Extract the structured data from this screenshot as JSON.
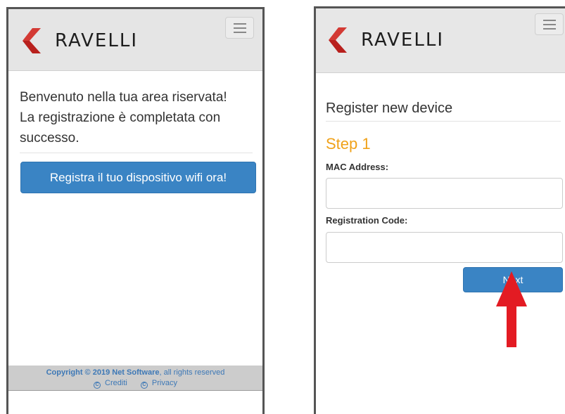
{
  "left_screen": {
    "brand": "RAVELLI",
    "welcome_line_1": "Benvenuto nella tua area riservata!",
    "welcome_line_2": "La registrazione è completata con successo.",
    "register_button": "Registra il tuo dispositivo wifi ora!",
    "footer": {
      "copyright_prefix": "Copyright © 2019 Net Software",
      "copyright_suffix": ", all rights reserved",
      "credits": "Crediti",
      "privacy": "Privacy"
    }
  },
  "right_screen": {
    "brand": "RAVELLI",
    "page_title": "Register new device",
    "step_title": "Step 1",
    "mac_label": "MAC Address:",
    "mac_value": "",
    "code_label": "Registration Code:",
    "code_value": "",
    "next_button": "Next"
  },
  "colors": {
    "brand_red": "#d33a34",
    "button_blue": "#3a84c4",
    "step_orange": "#f0a21a",
    "arrow_red": "#e31b23"
  },
  "icons": [
    "ravelli-logo-icon",
    "hamburger-menu-icon",
    "copyright-icon",
    "arrow-up-icon"
  ]
}
